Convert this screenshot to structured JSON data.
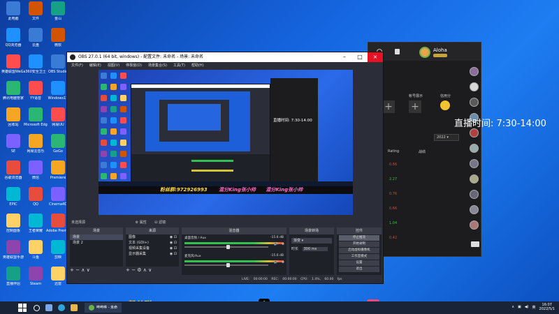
{
  "desktop": {
    "icons": [
      "此电脑",
      "QQ浏览器",
      "英雄联盟WeGame版",
      "腾讯电脑管家",
      "回收站",
      "SE",
      "谷歌浏览器",
      "EPIC",
      "控制面板",
      "英雄联盟手游",
      "直播伴侣",
      "文件",
      "云盘",
      "360安全卫士",
      "YY语音",
      "Microsoft Edge",
      "网易云音乐",
      "微信",
      "QQ",
      "王者荣耀",
      "斗鱼",
      "Steam",
      "金山",
      "微软",
      "OBS Studio",
      "Windows11",
      "网易UU",
      "GoGo",
      "Premiere",
      "Cinema4D",
      "Adobe Premiere",
      "剪映",
      "迅雷"
    ]
  },
  "obs": {
    "title": "OBS 27.0.1 (64 bit, windows) - 配置文件: 未命名 - 场景: 未命名",
    "menu": [
      "文件(F)",
      "编辑(E)",
      "视图(V)",
      "停靠窗(D)",
      "场景集合(S)",
      "工具(T)",
      "帮助(H)"
    ],
    "source_tag": "未选择源",
    "dock_props": "属性",
    "dock_filters": "滤镜",
    "scenes_header": "场景",
    "sources_header": "来源",
    "mixer_header": "混音器",
    "transitions_header": "场景转场",
    "controls_header": "控件",
    "scenes": [
      "场景",
      "场景 2"
    ],
    "sources": [
      "图像",
      "文本 (GDI+)",
      "视频采集设备",
      "显示器采集"
    ],
    "mixer": [
      {
        "name": "桌面音频 / Aux",
        "db": "-15.6 dB"
      },
      {
        "name": "麦克风/Aux",
        "db": "-15.6 dB"
      }
    ],
    "transition_type": "渐变",
    "duration_label": "时长",
    "duration_value": "300 ms",
    "controls": [
      "停止推流",
      "开始录制",
      "启动虚拟摄像机",
      "工作室模式",
      "设置",
      "退出"
    ],
    "status": "LIVE: 00:00:00   REC: 00:00:00   CPU: 1.4%, 60.00 fps"
  },
  "live_app": {
    "username": "Aloha",
    "col_rating": "Rating",
    "col_score": "战绩",
    "year": "2022",
    "btn_account": "帐号展示",
    "btn_credit": "信用分",
    "ratings": [
      "0.66",
      "2.27",
      "0.76",
      "0.66",
      "1.04",
      "0.42"
    ],
    "rating_colors": [
      "#e04040",
      "#3fbf3f",
      "#e04040",
      "#e04040",
      "#3fbf3f",
      "#e04040"
    ]
  },
  "overlay": {
    "live_time": "直播时间: 7:30-14:00",
    "fans_label": "粉丝群:",
    "fans_number": "972926993",
    "tiktok_name": "混分King张小帅",
    "lele_name": "混分King张小帅"
  },
  "taskbar": {
    "time": "16:07",
    "date": "2022/5/1",
    "active_app": "哔哔哗 - 未命",
    "lang": "英"
  }
}
